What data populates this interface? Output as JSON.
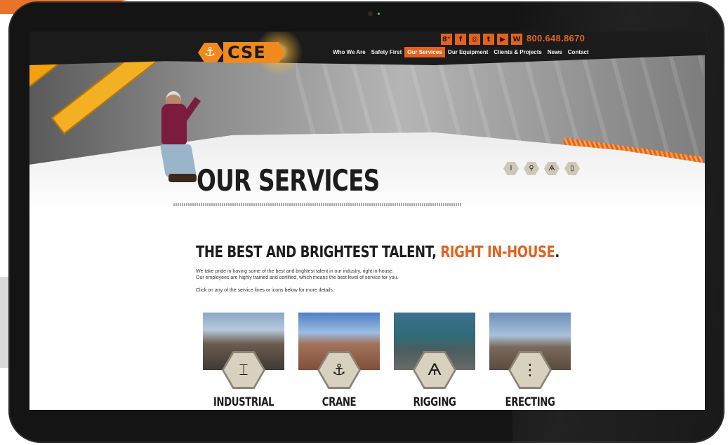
{
  "brand": {
    "logo_text": "CSE",
    "logo_icon": "crane-hook-icon",
    "accent": "#e3621f"
  },
  "header": {
    "phone": "800.648.8670",
    "social": [
      {
        "name": "google-plus-icon",
        "glyph": "8⁺"
      },
      {
        "name": "facebook-icon",
        "glyph": "f"
      },
      {
        "name": "instagram-icon",
        "glyph": "◎"
      },
      {
        "name": "twitter-icon",
        "glyph": "t"
      },
      {
        "name": "youtube-icon",
        "glyph": "▶"
      },
      {
        "name": "wordpress-icon",
        "glyph": "W"
      }
    ],
    "nav": [
      "Who We Are",
      "Safety First",
      "Our Services",
      "Our Equipment",
      "Clients & Projects",
      "News",
      "Contact"
    ],
    "nav_active": "Our Services"
  },
  "page": {
    "title": "OUR SERVICES",
    "mini_icons": [
      "I",
      "⚲",
      "Ѧ",
      "▯"
    ],
    "headline_main": "THE BEST AND BRIGHTEST TALENT, ",
    "headline_accent": "RIGHT IN-HOUSE",
    "headline_end": ".",
    "para_line1": "We take pride in having some of the best and brightest talent in our industry, right in-house.",
    "para_line2": "Our employees are highly trained and certified, which means the best level of service for you.",
    "para2": "Click on any of the service lines or icons below for more details."
  },
  "services": [
    {
      "label": "INDUSTRIAL",
      "icon": "I-beam-icon",
      "glyph": "⌶"
    },
    {
      "label": "CRANE",
      "icon": "crane-hook-icon",
      "glyph": "⚓"
    },
    {
      "label": "RIGGING",
      "icon": "rigging-icon",
      "glyph": "Ѧ"
    },
    {
      "label": "ERECTING",
      "icon": "erecting-icon",
      "glyph": "⋮"
    }
  ]
}
